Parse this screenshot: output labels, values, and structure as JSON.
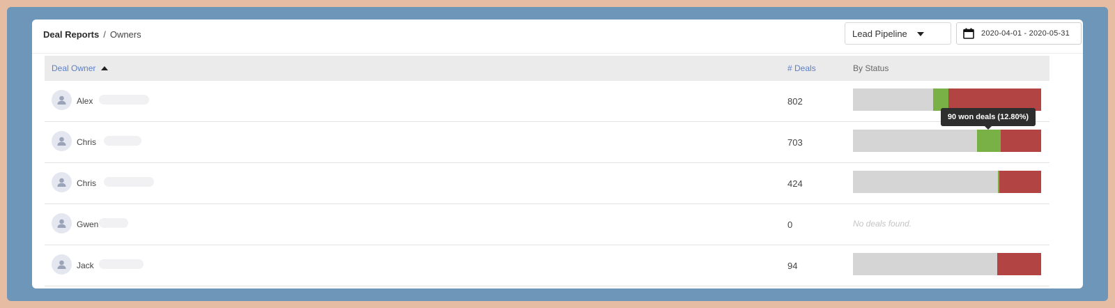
{
  "breadcrumb": {
    "section": "Deal Reports",
    "separator": "/",
    "page": "Owners"
  },
  "filters": {
    "pipeline": "Lead Pipeline",
    "date_range": "2020-04-01 - 2020-05-31"
  },
  "table": {
    "headers": {
      "owner": "Deal Owner",
      "deals": "# Deals",
      "status": "By Status"
    },
    "rows": [
      {
        "name": "Alex",
        "deals": "802",
        "status": {
          "open": 0.425,
          "won": 0.083,
          "lost": 0.492
        }
      },
      {
        "name": "Chris",
        "deals": "703",
        "status": {
          "open": 0.659,
          "won": 0.128,
          "lost": 0.213
        }
      },
      {
        "name": "Chris",
        "deals": "424",
        "status": {
          "open": 0.77,
          "won": 0.007,
          "lost": 0.223
        }
      },
      {
        "name": "Gwen",
        "deals": "0",
        "status": null,
        "empty_label": "No deals found."
      },
      {
        "name": "Jack",
        "deals": "94",
        "status": {
          "open": 0.767,
          "won": 0.0,
          "lost": 0.233
        }
      }
    ]
  },
  "tooltip": {
    "text": "90 won deals (12.80%)"
  },
  "colors": {
    "open": "#d5d5d5",
    "won": "#79b146",
    "lost": "#b34444",
    "header_link": "#5b7fc7"
  }
}
